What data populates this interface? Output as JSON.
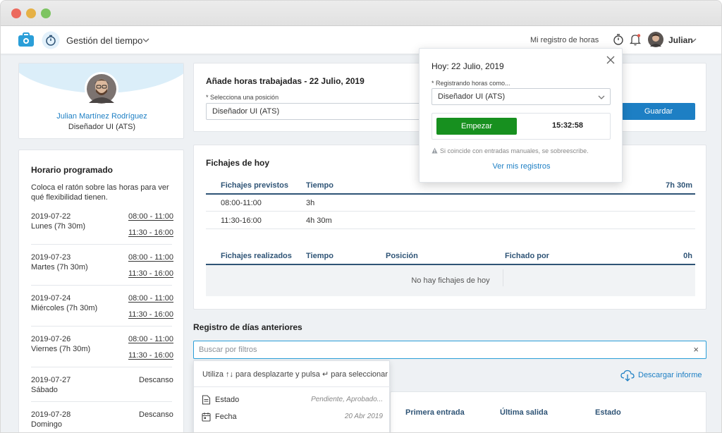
{
  "header": {
    "app_title": "Gestión del tiempo",
    "my_records_link": "Mi registro de horas",
    "user_name": "Julian"
  },
  "profile": {
    "name": "Julian Martínez Rodríguez",
    "role": "Diseñador UI (ATS)"
  },
  "schedule": {
    "title": "Horario programado",
    "hint": "Coloca el ratón sobre las horas para ver qué flexibilidad tienen.",
    "days": [
      {
        "date": "2019-07-22",
        "day": "Lunes (7h 30m)",
        "slot1": "08:00 - 11:00",
        "slot2": "11:30 - 16:00"
      },
      {
        "date": "2019-07-23",
        "day": "Martes (7h 30m)",
        "slot1": "08:00 - 11:00",
        "slot2": "11:30 - 16:00"
      },
      {
        "date": "2019-07-24",
        "day": "Miércoles (7h 30m)",
        "slot1": "08:00 - 11:00",
        "slot2": "11:30 - 16:00"
      },
      {
        "date": "2019-07-26",
        "day": "Viernes (7h 30m)",
        "slot1": "08:00 - 11:00",
        "slot2": "11:30 - 16:00"
      },
      {
        "date": "2019-07-27",
        "day": "Sábado",
        "status": "Descanso"
      },
      {
        "date": "2019-07-28",
        "day": "Domingo",
        "status": "Descanso"
      }
    ]
  },
  "add_hours": {
    "title": "Añade horas trabajadas - 22 Julio, 2019",
    "position_label": "* Selecciona una posición",
    "position_value": "Diseñador UI (ATS)",
    "save_button": "Guardar"
  },
  "today": {
    "title": "Fichajes de hoy",
    "planned": {
      "col1": "Fichajes previstos",
      "col2": "Tiempo",
      "total": "7h 30m",
      "rows": [
        {
          "range": "08:00-11:00",
          "time": "3h"
        },
        {
          "range": "11:30-16:00",
          "time": "4h 30m"
        }
      ]
    },
    "done": {
      "col1": "Fichajes realizados",
      "col2": "Tiempo",
      "col3": "Posición",
      "col4": "Fichado por",
      "total": "0h",
      "empty": "No hay fichajes de hoy"
    }
  },
  "previous": {
    "title": "Registro de días anteriores",
    "search_placeholder": "Buscar por filtros",
    "download": "Descargar informe",
    "columns": [
      "Primera entrada",
      "Última salida",
      "Estado"
    ]
  },
  "filter_dropdown": {
    "hint": "Utiliza ↑↓ para desplazarte y pulsa ↵ para seleccionar",
    "items": [
      {
        "label": "Estado",
        "hint": "Pendiente, Aprobado..."
      },
      {
        "label": "Fecha",
        "hint": "20 Abr 2019"
      }
    ]
  },
  "popup": {
    "date": "Hoy: 22 Julio, 2019",
    "label": "* Registrando horas como...",
    "select_value": "Diseñador UI (ATS)",
    "start_button": "Empezar",
    "timer": "15:32:58",
    "note": "Si coincide con entradas manuales, se sobreescribe.",
    "link": "Ver mis registros"
  },
  "colors": {
    "accent": "#1d7fc4",
    "start_green": "#17901f",
    "header_blue": "#2f5476",
    "profile_band": "#dbeef9"
  }
}
